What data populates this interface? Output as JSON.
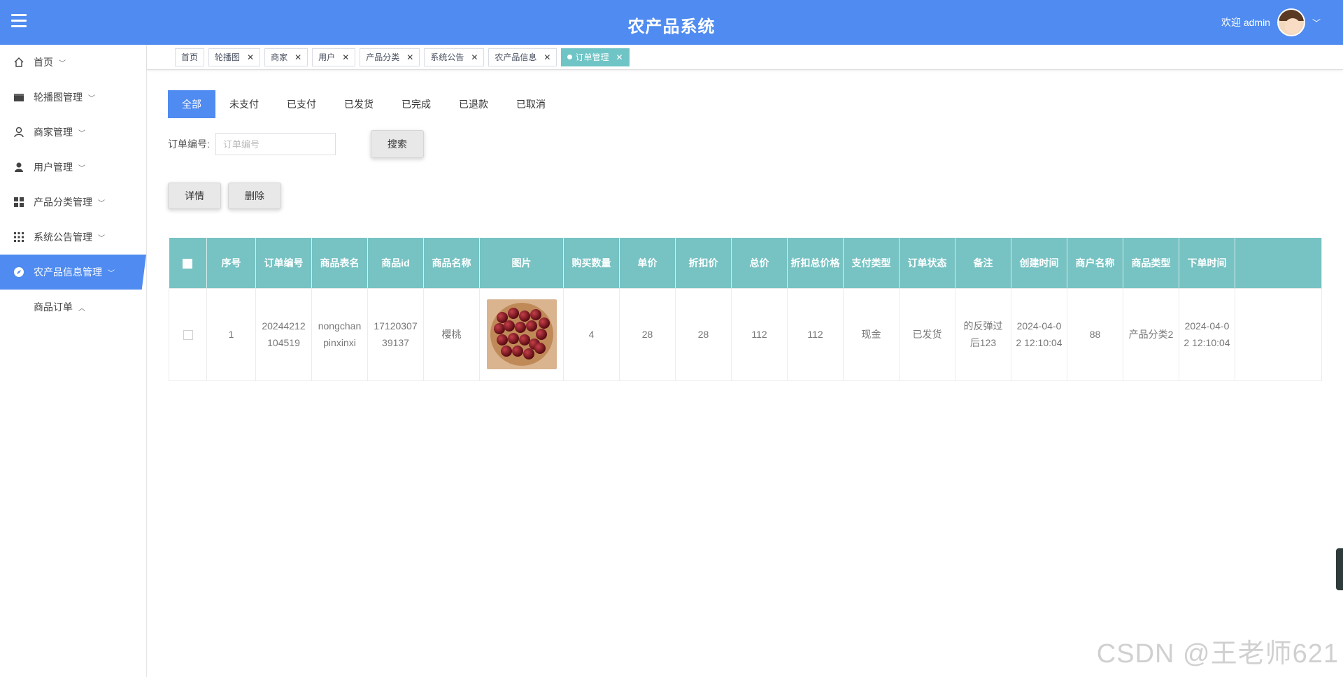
{
  "header": {
    "app_title": "农产品系统",
    "welcome": "欢迎 admin",
    "brand_color": "#4f8bf0"
  },
  "sidebar": {
    "items": [
      {
        "label": "首页",
        "icon": "home-icon"
      },
      {
        "label": "轮播图管理",
        "icon": "store-icon"
      },
      {
        "label": "商家管理",
        "icon": "merchant-icon"
      },
      {
        "label": "用户管理",
        "icon": "user-icon"
      },
      {
        "label": "产品分类管理",
        "icon": "grid-icon"
      },
      {
        "label": "系统公告管理",
        "icon": "apps-icon"
      },
      {
        "label": "农产品信息管理",
        "icon": "compass-icon"
      }
    ],
    "sub_items": [
      {
        "label": "商品订单"
      }
    ]
  },
  "tags": [
    {
      "label": "首页"
    },
    {
      "label": "轮播图"
    },
    {
      "label": "商家"
    },
    {
      "label": "用户"
    },
    {
      "label": "产品分类"
    },
    {
      "label": "系统公告"
    },
    {
      "label": "农产品信息"
    },
    {
      "label": "订单管理"
    }
  ],
  "status_tabs": [
    "全部",
    "未支付",
    "已支付",
    "已发货",
    "已完成",
    "已退款",
    "已取消"
  ],
  "search": {
    "label": "订单编号:",
    "placeholder": "订单编号",
    "button": "搜索"
  },
  "actions": {
    "detail": "详情",
    "delete": "删除"
  },
  "table": {
    "headers": [
      "序号",
      "订单编号",
      "商品表名",
      "商品id",
      "商品名称",
      "图片",
      "购买数量",
      "单价",
      "折扣价",
      "总价",
      "折扣总价格",
      "支付类型",
      "订单状态",
      "备注",
      "创建时间",
      "商户名称",
      "商品类型",
      "下单时间"
    ],
    "rows": [
      {
        "index": "1",
        "order_no": "20244212104519",
        "table_name": "nongchanpinxinxi",
        "goods_id": "1712030739137",
        "goods_name": "樱桃",
        "image": "cherry-photo",
        "quantity": "4",
        "unit_price": "28",
        "discount_price": "28",
        "total": "112",
        "discount_total": "112",
        "pay_type": "现金",
        "status": "已发货",
        "remark": "的反弹过后123",
        "created": "2024-04-02 12:10:04",
        "merchant": "88",
        "goods_type": "产品分类2",
        "order_time": "2024-04-02 12:10:04"
      }
    ],
    "header_color": "#77c2c3"
  },
  "watermark": "CSDN @王老师621"
}
